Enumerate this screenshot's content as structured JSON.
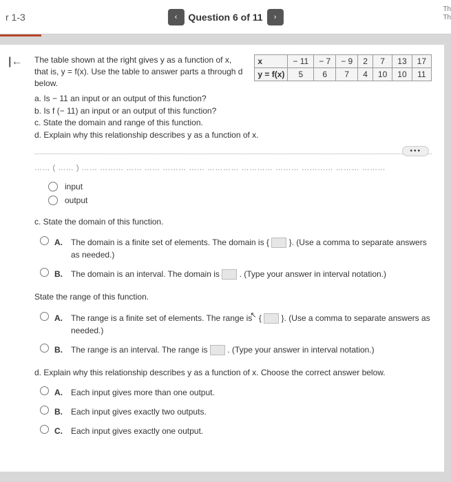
{
  "header": {
    "crumb": "r 1-3",
    "prev_icon": "‹",
    "question_label": "Question 6 of 11",
    "next_icon": "›",
    "right_tab_1": "Th",
    "right_tab_2": "Th"
  },
  "collapse_icon": "|←",
  "intro": "The table shown at the right gives y as a function of x, that is, y = f(x). Use the table to answer parts a through d below.",
  "table": {
    "row_labels": [
      "x",
      "y = f(x)"
    ],
    "x_values": [
      "− 11",
      "− 7",
      "− 9",
      "2",
      "7",
      "13",
      "17"
    ],
    "y_values": [
      "5",
      "6",
      "7",
      "4",
      "10",
      "10",
      "11"
    ]
  },
  "parts": {
    "a": "a. Is − 11 an input or an output of this function?",
    "b": "b. Is f (− 11) an input or an output of this function?",
    "c": "c. State the domain and range of this function.",
    "d": "d. Explain why this relationship describes y as a function of x."
  },
  "dots": "•••",
  "scroll_hint": "…… ( …… ) …… ……… …… …… ……… …… ………… ………… ……… ………… ……… ………",
  "io_options": {
    "input": "input",
    "output": "output"
  },
  "c_label": "c. State the domain of this function.",
  "domain_choices": {
    "A": "The domain is a finite set of elements. The domain is {",
    "A_tail": "}. (Use a comma to separate answers as needed.)",
    "B": "The domain is an interval. The domain is ",
    "B_tail": ". (Type your answer in interval notation.)"
  },
  "range_label": "State the range of this function.",
  "range_choices": {
    "A_pre": "The range is a finite set of elements. The range is",
    "A_brace_open": "{",
    "A_tail": "}. (Use a comma to separate answers as needed.)",
    "B": "The range is an interval. The range is ",
    "B_tail": ". (Type your answer in interval notation.)"
  },
  "d_label": "d. Explain why this relationship describes y as a function of x. Choose the correct answer below.",
  "d_choices": {
    "A": "Each input gives more than one output.",
    "B": "Each input gives exactly two outputs.",
    "C": "Each input gives exactly one output."
  },
  "letters": {
    "A": "A.",
    "B": "B.",
    "C": "C."
  }
}
